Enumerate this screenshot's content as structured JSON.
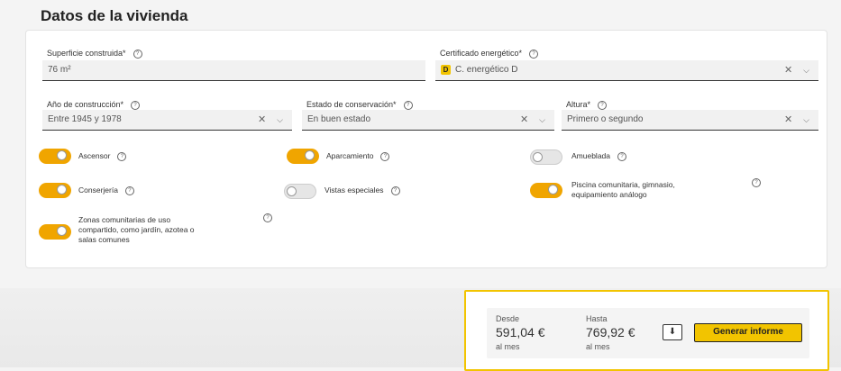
{
  "section": {
    "title": "Datos de la vivienda"
  },
  "fields": {
    "superficie": {
      "label": "Superficie construida*",
      "value": "76 m²"
    },
    "certificado": {
      "label": "Certificado energético*",
      "badge": "D",
      "value": "C. energético D"
    },
    "anio": {
      "label": "Año de construcción*",
      "value": "Entre 1945 y 1978"
    },
    "estado": {
      "label": "Estado de conservación*",
      "value": "En buen estado"
    },
    "altura": {
      "label": "Altura*",
      "value": "Primero o segundo"
    }
  },
  "icons": {
    "help": "?",
    "clear": "✕",
    "dropdown": "⌵",
    "download": "⬇"
  },
  "toggles": {
    "ascensor": {
      "label": "Ascensor",
      "on": true
    },
    "aparcamiento": {
      "label": "Aparcamiento",
      "on": true
    },
    "amueblada": {
      "label": "Amueblada",
      "on": false
    },
    "conserjeria": {
      "label": "Conserjería",
      "on": true
    },
    "vistas": {
      "label": "Vistas especiales",
      "on": false
    },
    "piscina": {
      "label_line1": "Piscina comunitaria, gimnasio,",
      "label_line2": "equipamiento análogo",
      "on": true
    },
    "zonas": {
      "label_line1": "Zonas comunitarias de uso",
      "label_line2": "compartido, como jardín, azotea o",
      "label_line3": "salas comunes",
      "on": true
    }
  },
  "price": {
    "desde_label": "Desde",
    "desde_value": "591,04 €",
    "desde_unit": "al mes",
    "hasta_label": "Hasta",
    "hasta_value": "769,92 €",
    "hasta_unit": "al mes",
    "generate_label": "Generar informe"
  },
  "colors": {
    "accent": "#f2c400",
    "toggle_on": "#f0a500"
  }
}
